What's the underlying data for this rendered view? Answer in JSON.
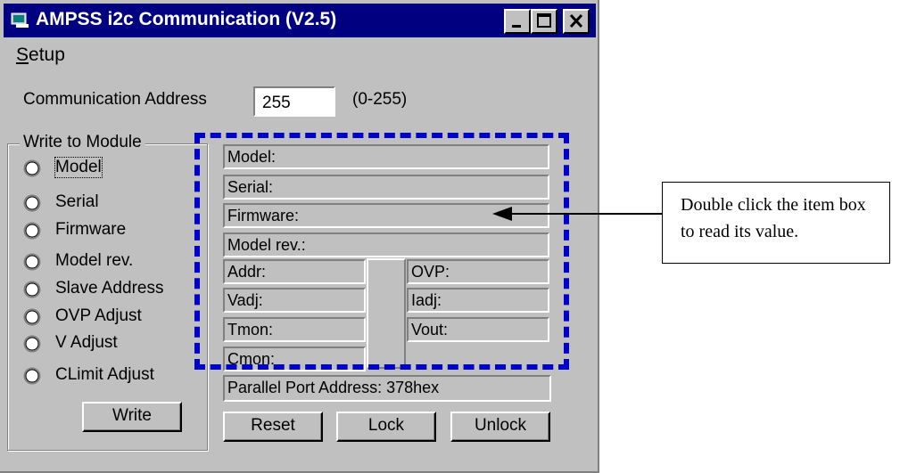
{
  "window": {
    "title": "AMPSS i2c Communication (V2.5)",
    "controls": [
      "minimize",
      "maximize",
      "close"
    ]
  },
  "menu": {
    "setup_first": "S",
    "setup_rest": "etup"
  },
  "communication": {
    "label": "Communication Address",
    "value": "255",
    "range": "(0-255)"
  },
  "write_group": {
    "title": "Write to Module",
    "options": [
      "Model",
      "Serial",
      "Firmware",
      "Model rev.",
      "Slave Address",
      "OVP Adjust",
      "V Adjust",
      "CLimit Adjust"
    ],
    "focused_option": "Model",
    "write_button": "Write"
  },
  "info_fields": {
    "model": "Model:",
    "serial": "Serial:",
    "firmware": "Firmware:",
    "model_rev": "Model rev.:",
    "addr": "Addr:",
    "vadj": "Vadj:",
    "tmon": "Tmon:",
    "cmon": "Cmon:",
    "ovp": "OVP:",
    "iadj": "Iadj:",
    "vout": "Vout:"
  },
  "parallel_port": "Parallel Port Address: 378hex",
  "buttons": {
    "reset": "Reset",
    "lock": "Lock",
    "unlock": "Unlock"
  },
  "annotation": {
    "text": "Double click the item box to read its value.",
    "highlight_color": "#0000cc"
  },
  "colors": {
    "titlebar": "#000080",
    "face": "#c0c0c0"
  }
}
